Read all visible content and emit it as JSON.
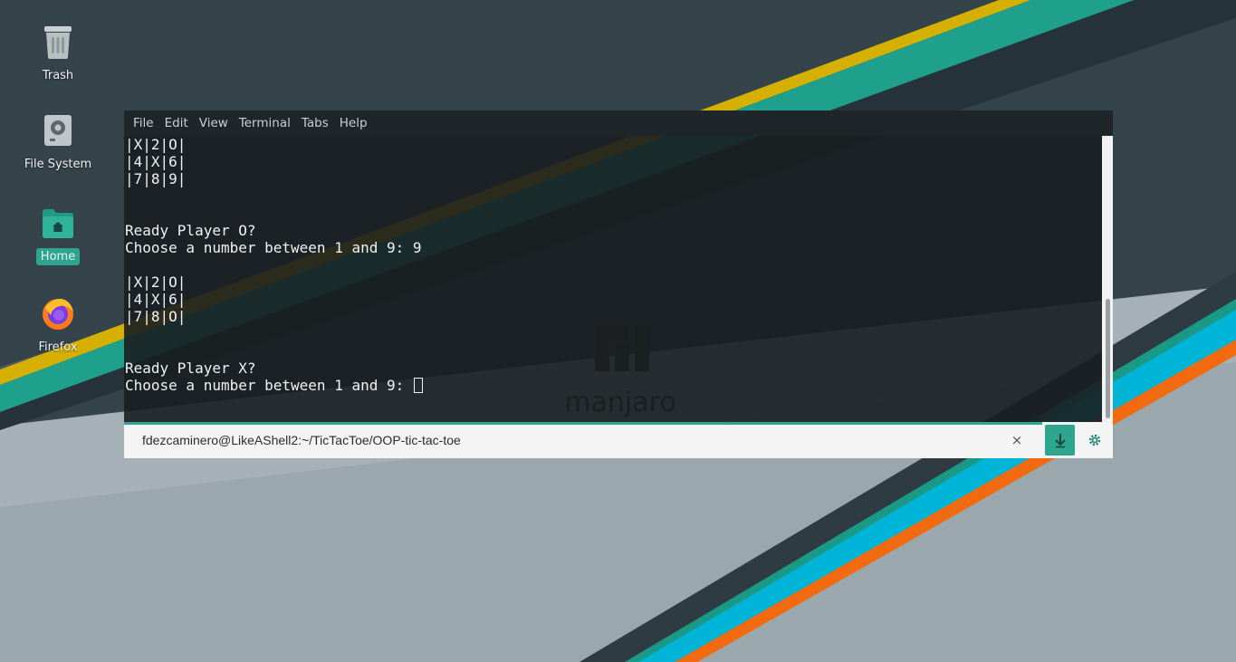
{
  "desktop": {
    "icons": [
      {
        "label": "Trash",
        "icon": "trash-icon"
      },
      {
        "label": "File System",
        "icon": "drive-icon"
      },
      {
        "label": "Home",
        "icon": "home-folder-icon",
        "selected": true
      },
      {
        "label": "Firefox",
        "icon": "firefox-icon"
      }
    ],
    "wallpaper_text": "manjaro"
  },
  "terminal": {
    "menu": [
      "File",
      "Edit",
      "View",
      "Terminal",
      "Tabs",
      "Help"
    ],
    "output": "|X|2|O|\n|4|X|6|\n|7|8|9|\n\n\nReady Player O?\nChoose a number between 1 and 9: 9\n\n|X|2|O|\n|4|X|6|\n|7|8|O|\n\n\nReady Player X?\nChoose a number between 1 and 9: ",
    "tab_title": "fdezcaminero@LikeAShell2:~/TicTacToe/OOP-tic-tac-toe",
    "close_glyph": "×"
  },
  "colors": {
    "accent": "#2ea58f",
    "yellow": "#d6b000",
    "cyan": "#00b7d9",
    "orange": "#f26a10"
  }
}
